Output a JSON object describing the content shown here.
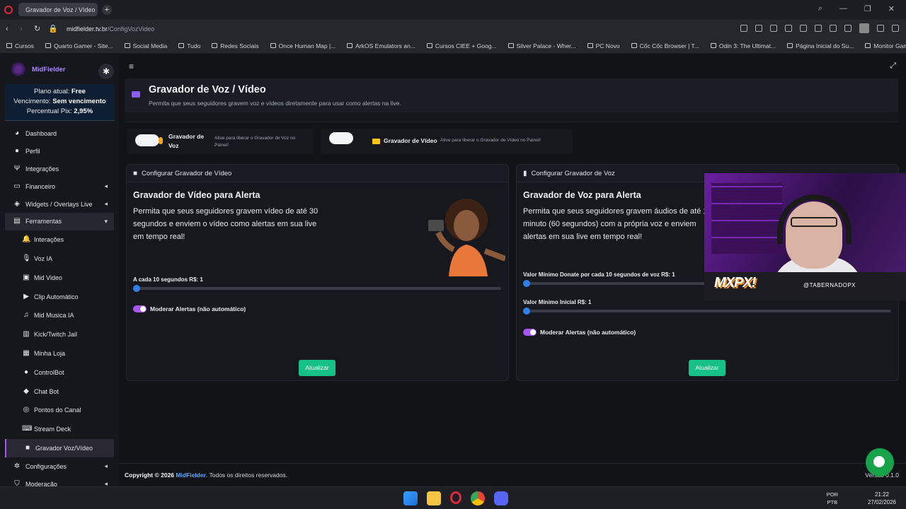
{
  "browser": {
    "tab_title": "Gravador de Voz / Vídeo",
    "url_host": "midfielder.tv.br",
    "url_path": "/ConfigVozVideo",
    "bookmarks": [
      "Cursos",
      "Quarto Gamer - Site...",
      "Social Media",
      "Tudo",
      "Redes Sociais",
      "Once Human Map |...",
      "ArkOS Emulators an...",
      "Cursos CIEE + Goog...",
      "Silver Palace - Wher...",
      "PC Novo",
      "Cốc Cốc Browser | T...",
      "Odin 3: The Ultimat...",
      "Página Inicial do Su...",
      "Monitor Gamer Sup..."
    ]
  },
  "sidebar": {
    "brand": "MidFielder",
    "plan_label": "Plano atual:",
    "plan_value": "Free",
    "due_label": "Vencimento:",
    "due_value": "Sem vencimento",
    "pix_label": "Percentual Pix:",
    "pix_value": "2,95%",
    "items": [
      {
        "label": "Dashboard",
        "icon": "dashboard-icon"
      },
      {
        "label": "Perfil",
        "icon": "user-icon"
      },
      {
        "label": "Integrações",
        "icon": "plug-icon"
      },
      {
        "label": "Financeiro",
        "icon": "wallet-icon"
      },
      {
        "label": "Widgets / Overlays Live",
        "icon": "layers-icon"
      },
      {
        "label": "Ferramentas",
        "icon": "toolbox-icon"
      }
    ],
    "subitems": [
      "Interações",
      "Voz IA",
      "Mid Video",
      "Clip Automático",
      "Mid Musica IA",
      "Kick/Twitch Jail",
      "Minha Loja",
      "ControlBot",
      "Chat Bot",
      "Pontos do Canal",
      "Stream Deck",
      "Gravador Voz/Vídeo"
    ],
    "bottom_items": [
      "Configurações",
      "Moderação"
    ]
  },
  "page": {
    "title": "Gravador de Voz / Vídeo",
    "subtitle": "Permita que seus seguidores gravem voz e vídeos diretamente para usar como alertas na live."
  },
  "toggles": {
    "voice_label": "Gravador de Voz",
    "voice_desc": "Ative para liberar o Gravador de Voz no Painel!",
    "video_label": "Gravador de Vídeo",
    "video_desc": "Ative para liberar o Gravador de Vídeo no Painel!"
  },
  "video_panel": {
    "header": "Configurar Gravador de Vídeo",
    "title": "Gravador de Vídeo para Alerta",
    "text": "Permita que seus seguidores gravem vídeo de até 30 segundos e enviem o vídeo como alertas em sua live em tempo real!",
    "slider_label": "A cada 10 segundos R$: 1",
    "slider_value": 1,
    "moderate_label": "Moderar Alertas (não automático)",
    "button": "Atualizar"
  },
  "voice_panel": {
    "header": "Configurar Gravador de Voz",
    "title": "Gravador de Voz para Alerta",
    "text": "Permita que seus seguidores gravem áudios de até 1 minuto (60 segundos) com a própria voz e enviem alertas em sua live em tempo real!",
    "slider1_label": "Valor Mínimo Donate por cada 10 segundos de voz R$: 1",
    "slider2_label": "Valor Mínimo Inicial R$: 1",
    "moderate_label": "Moderar Alertas (não automático)",
    "button": "Atualizar"
  },
  "overlay": {
    "logo": "MXPX!",
    "handle": "@TABERNADOPX"
  },
  "footer": {
    "copyright": "Copyright © 2026",
    "brand": "MidFielder",
    "rights": ". Todos os direitos reservados.",
    "version": "Versão 0.1.0"
  },
  "taskbar": {
    "lang1": "POR",
    "lang2": "PTB",
    "time": "21:22",
    "date": "27/02/2026"
  },
  "colors": {
    "accent": "#a855f7",
    "success": "#15c187",
    "link": "#5aa9ff",
    "slider": "#2f80ed"
  }
}
